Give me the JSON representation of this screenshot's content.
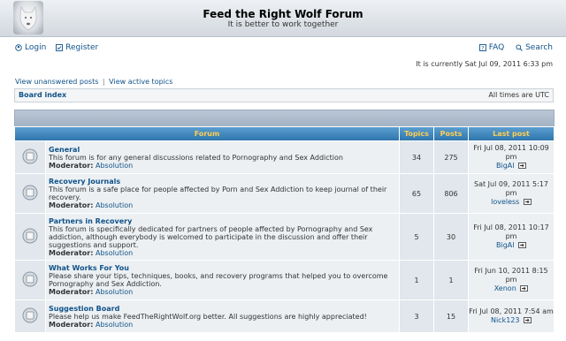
{
  "header": {
    "site_title": "Feed the Right Wolf Forum",
    "site_description": "It is better to work together"
  },
  "nav": {
    "login": "Login",
    "register": "Register",
    "faq": "FAQ",
    "search": "Search"
  },
  "current_time": "It is currently Sat Jul 09, 2011 6:33 pm",
  "quick_links": {
    "unanswered": "View unanswered posts",
    "separator": "|",
    "active": "View active topics"
  },
  "breadcrumb": {
    "board_index": "Board index",
    "timezone": "All times are UTC"
  },
  "table": {
    "headers": {
      "forum": "Forum",
      "topics": "Topics",
      "posts": "Posts",
      "last_post": "Last post"
    },
    "rows": [
      {
        "name": "General",
        "description": "This forum is for any general discussions related to Pornography and Sex Addiction",
        "moderator_label": "Moderator:",
        "moderator": "Absolution",
        "topics": "34",
        "posts": "275",
        "last_date": "Fri Jul 08, 2011 10:09 pm",
        "last_user": "BigAl"
      },
      {
        "name": "Recovery Journals",
        "description": "This forum is a safe place for people affected by Porn and Sex Addiction to keep journal of their recovery.",
        "moderator_label": "Moderator:",
        "moderator": "Absolution",
        "topics": "65",
        "posts": "806",
        "last_date": "Sat Jul 09, 2011 5:17 pm",
        "last_user": "loveless"
      },
      {
        "name": "Partners in Recovery",
        "description": "This forum is specifically dedicated for partners of people affected by Pornography and Sex addiction, although everybody is welcomed to participate in the discussion and offer their suggestions and support.",
        "moderator_label": "Moderator:",
        "moderator": "Absolution",
        "topics": "5",
        "posts": "30",
        "last_date": "Fri Jul 08, 2011 10:17 pm",
        "last_user": "BigAl"
      },
      {
        "name": "What Works For You",
        "description": "Please share your tips, techniques, books, and recovery programs that helped you to overcome Pornography and Sex Addiction.",
        "moderator_label": "Moderator:",
        "moderator": "Absolution",
        "topics": "1",
        "posts": "1",
        "last_date": "Fri Jun 10, 2011 8:15 pm",
        "last_user": "Xenon"
      },
      {
        "name": "Suggestion Board",
        "description": "Please help us make FeedTheRightWolf.org better. All suggestions are highly appreciated!",
        "moderator_label": "Moderator:",
        "moderator": "Absolution",
        "topics": "3",
        "posts": "15",
        "last_date": "Fri Jul 08, 2011 7:54 am",
        "last_user": "Nick123"
      }
    ]
  },
  "icons": {
    "logo": "wolf-logo",
    "login": "login-icon",
    "register": "register-icon",
    "faq": "faq-icon",
    "search": "search-icon",
    "forum": "forum-read-icon",
    "last_post": "view-latest-post-icon"
  },
  "colors": {
    "header_bg": "#d2d8de",
    "table_header": "#2f76ad",
    "table_header_text": "#ffce52",
    "link": "#105289",
    "row_bg": "#ecf0f3"
  }
}
